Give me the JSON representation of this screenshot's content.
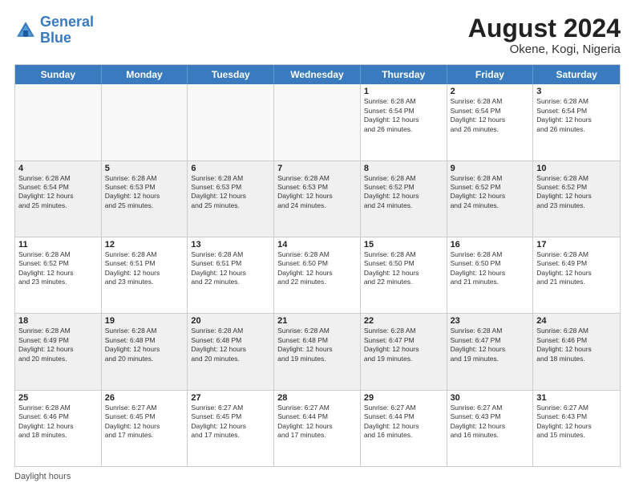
{
  "header": {
    "logo_line1": "General",
    "logo_line2": "Blue",
    "month_year": "August 2024",
    "location": "Okene, Kogi, Nigeria"
  },
  "footer": {
    "label": "Daylight hours"
  },
  "days_of_week": [
    "Sunday",
    "Monday",
    "Tuesday",
    "Wednesday",
    "Thursday",
    "Friday",
    "Saturday"
  ],
  "weeks": [
    [
      {
        "day": "",
        "info": "",
        "empty": true
      },
      {
        "day": "",
        "info": "",
        "empty": true
      },
      {
        "day": "",
        "info": "",
        "empty": true
      },
      {
        "day": "",
        "info": "",
        "empty": true
      },
      {
        "day": "1",
        "info": "Sunrise: 6:28 AM\nSunset: 6:54 PM\nDaylight: 12 hours\nand 26 minutes.",
        "empty": false
      },
      {
        "day": "2",
        "info": "Sunrise: 6:28 AM\nSunset: 6:54 PM\nDaylight: 12 hours\nand 26 minutes.",
        "empty": false
      },
      {
        "day": "3",
        "info": "Sunrise: 6:28 AM\nSunset: 6:54 PM\nDaylight: 12 hours\nand 26 minutes.",
        "empty": false
      }
    ],
    [
      {
        "day": "4",
        "info": "Sunrise: 6:28 AM\nSunset: 6:54 PM\nDaylight: 12 hours\nand 25 minutes.",
        "empty": false
      },
      {
        "day": "5",
        "info": "Sunrise: 6:28 AM\nSunset: 6:53 PM\nDaylight: 12 hours\nand 25 minutes.",
        "empty": false
      },
      {
        "day": "6",
        "info": "Sunrise: 6:28 AM\nSunset: 6:53 PM\nDaylight: 12 hours\nand 25 minutes.",
        "empty": false
      },
      {
        "day": "7",
        "info": "Sunrise: 6:28 AM\nSunset: 6:53 PM\nDaylight: 12 hours\nand 24 minutes.",
        "empty": false
      },
      {
        "day": "8",
        "info": "Sunrise: 6:28 AM\nSunset: 6:52 PM\nDaylight: 12 hours\nand 24 minutes.",
        "empty": false
      },
      {
        "day": "9",
        "info": "Sunrise: 6:28 AM\nSunset: 6:52 PM\nDaylight: 12 hours\nand 24 minutes.",
        "empty": false
      },
      {
        "day": "10",
        "info": "Sunrise: 6:28 AM\nSunset: 6:52 PM\nDaylight: 12 hours\nand 23 minutes.",
        "empty": false
      }
    ],
    [
      {
        "day": "11",
        "info": "Sunrise: 6:28 AM\nSunset: 6:52 PM\nDaylight: 12 hours\nand 23 minutes.",
        "empty": false
      },
      {
        "day": "12",
        "info": "Sunrise: 6:28 AM\nSunset: 6:51 PM\nDaylight: 12 hours\nand 23 minutes.",
        "empty": false
      },
      {
        "day": "13",
        "info": "Sunrise: 6:28 AM\nSunset: 6:51 PM\nDaylight: 12 hours\nand 22 minutes.",
        "empty": false
      },
      {
        "day": "14",
        "info": "Sunrise: 6:28 AM\nSunset: 6:50 PM\nDaylight: 12 hours\nand 22 minutes.",
        "empty": false
      },
      {
        "day": "15",
        "info": "Sunrise: 6:28 AM\nSunset: 6:50 PM\nDaylight: 12 hours\nand 22 minutes.",
        "empty": false
      },
      {
        "day": "16",
        "info": "Sunrise: 6:28 AM\nSunset: 6:50 PM\nDaylight: 12 hours\nand 21 minutes.",
        "empty": false
      },
      {
        "day": "17",
        "info": "Sunrise: 6:28 AM\nSunset: 6:49 PM\nDaylight: 12 hours\nand 21 minutes.",
        "empty": false
      }
    ],
    [
      {
        "day": "18",
        "info": "Sunrise: 6:28 AM\nSunset: 6:49 PM\nDaylight: 12 hours\nand 20 minutes.",
        "empty": false
      },
      {
        "day": "19",
        "info": "Sunrise: 6:28 AM\nSunset: 6:48 PM\nDaylight: 12 hours\nand 20 minutes.",
        "empty": false
      },
      {
        "day": "20",
        "info": "Sunrise: 6:28 AM\nSunset: 6:48 PM\nDaylight: 12 hours\nand 20 minutes.",
        "empty": false
      },
      {
        "day": "21",
        "info": "Sunrise: 6:28 AM\nSunset: 6:48 PM\nDaylight: 12 hours\nand 19 minutes.",
        "empty": false
      },
      {
        "day": "22",
        "info": "Sunrise: 6:28 AM\nSunset: 6:47 PM\nDaylight: 12 hours\nand 19 minutes.",
        "empty": false
      },
      {
        "day": "23",
        "info": "Sunrise: 6:28 AM\nSunset: 6:47 PM\nDaylight: 12 hours\nand 19 minutes.",
        "empty": false
      },
      {
        "day": "24",
        "info": "Sunrise: 6:28 AM\nSunset: 6:46 PM\nDaylight: 12 hours\nand 18 minutes.",
        "empty": false
      }
    ],
    [
      {
        "day": "25",
        "info": "Sunrise: 6:28 AM\nSunset: 6:46 PM\nDaylight: 12 hours\nand 18 minutes.",
        "empty": false
      },
      {
        "day": "26",
        "info": "Sunrise: 6:27 AM\nSunset: 6:45 PM\nDaylight: 12 hours\nand 17 minutes.",
        "empty": false
      },
      {
        "day": "27",
        "info": "Sunrise: 6:27 AM\nSunset: 6:45 PM\nDaylight: 12 hours\nand 17 minutes.",
        "empty": false
      },
      {
        "day": "28",
        "info": "Sunrise: 6:27 AM\nSunset: 6:44 PM\nDaylight: 12 hours\nand 17 minutes.",
        "empty": false
      },
      {
        "day": "29",
        "info": "Sunrise: 6:27 AM\nSunset: 6:44 PM\nDaylight: 12 hours\nand 16 minutes.",
        "empty": false
      },
      {
        "day": "30",
        "info": "Sunrise: 6:27 AM\nSunset: 6:43 PM\nDaylight: 12 hours\nand 16 minutes.",
        "empty": false
      },
      {
        "day": "31",
        "info": "Sunrise: 6:27 AM\nSunset: 6:43 PM\nDaylight: 12 hours\nand 15 minutes.",
        "empty": false
      }
    ]
  ]
}
